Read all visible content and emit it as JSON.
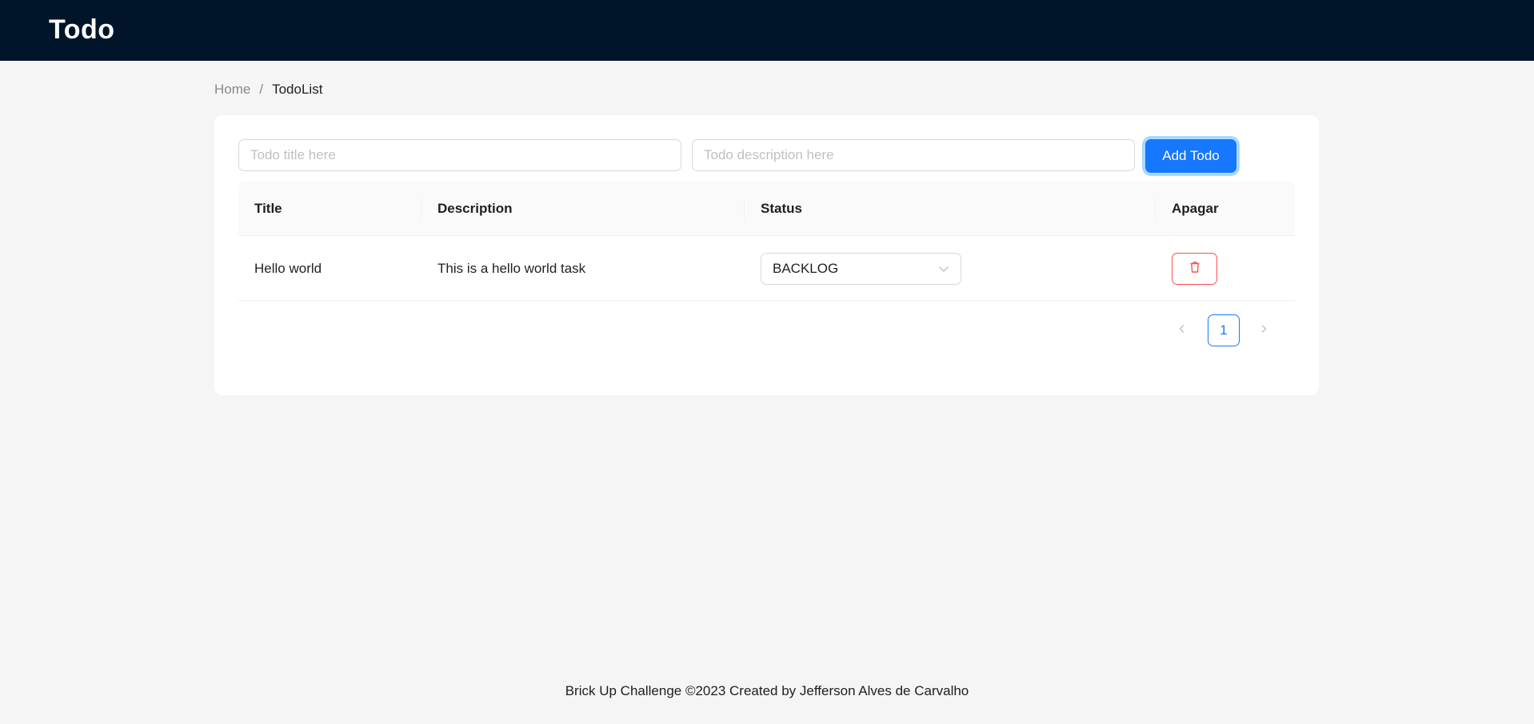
{
  "header": {
    "logo": "Todo"
  },
  "breadcrumb": {
    "home": "Home",
    "separator": "/",
    "current": "TodoList"
  },
  "form": {
    "title_placeholder": "Todo title here",
    "description_placeholder": "Todo description here",
    "add_button": "Add Todo"
  },
  "table": {
    "columns": [
      "Title",
      "Description",
      "Status",
      "Apagar"
    ],
    "rows": [
      {
        "title": "Hello world",
        "description": "This is a hello world task",
        "status": "BACKLOG"
      }
    ]
  },
  "pagination": {
    "current_page": "1"
  },
  "footer": {
    "text": "Brick Up Challenge ©2023 Created by Jefferson Alves de Carvalho"
  },
  "colors": {
    "header_bg": "#001529",
    "primary": "#1677ff",
    "danger": "#ff4d4f",
    "page_bg": "#f5f5f5"
  }
}
